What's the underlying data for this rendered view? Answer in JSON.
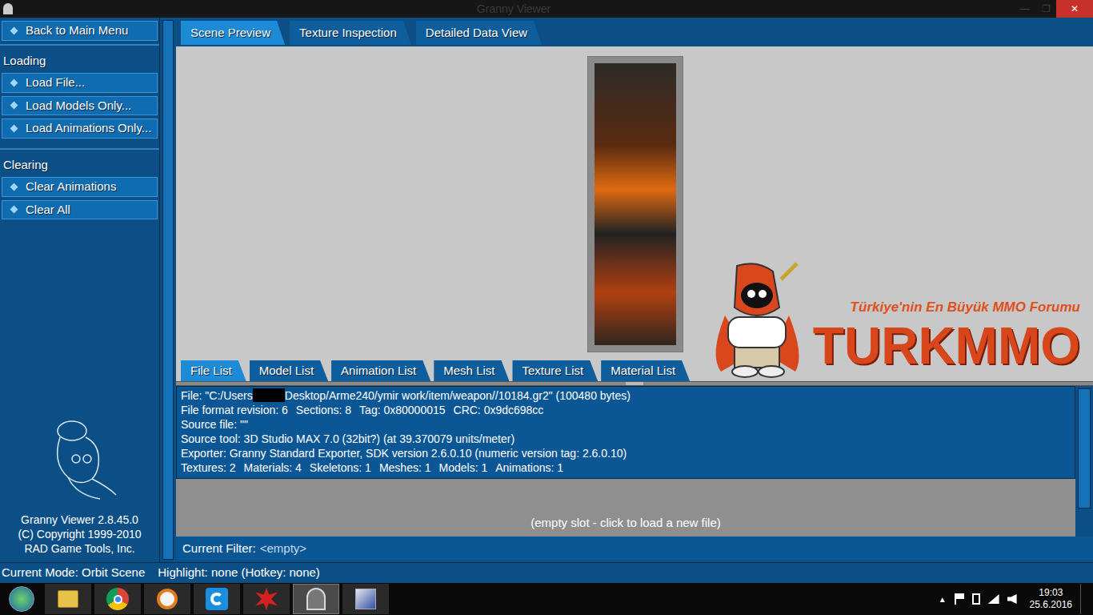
{
  "window": {
    "title": "Granny Viewer",
    "controls": [
      "—",
      "❐",
      "✕"
    ]
  },
  "sidebar": {
    "top": [
      "Back to Main Menu"
    ],
    "sections": [
      {
        "header": "Loading",
        "items": [
          "Load File...",
          "Load Models Only...",
          "Load Animations Only..."
        ]
      },
      {
        "header": "Clearing",
        "items": [
          "Clear Animations",
          "Clear All"
        ]
      }
    ],
    "credits": [
      "Granny Viewer 2.8.45.0",
      "(C) Copyright 1999-2010",
      "RAD Game Tools, Inc."
    ]
  },
  "main_tabs": [
    {
      "label": "Scene Preview",
      "selected": true
    },
    {
      "label": "Texture Inspection",
      "selected": false
    },
    {
      "label": "Detailed Data View",
      "selected": false
    }
  ],
  "preview": {
    "watermark": {
      "tagline": "Türkiye'nin En Büyük MMO Forumu",
      "name": "TURKMMO"
    }
  },
  "list_tabs": [
    {
      "label": "File List",
      "selected": true
    },
    {
      "label": "Model List",
      "selected": false
    },
    {
      "label": "Animation List",
      "selected": false
    },
    {
      "label": "Mesh List",
      "selected": false
    },
    {
      "label": "Texture List",
      "selected": false
    },
    {
      "label": "Material List",
      "selected": false
    }
  ],
  "file_info": {
    "path_before": "File: \"C:/Users",
    "path_redacted": true,
    "path_after": "Desktop/Arme240/ymir work/item/weapon//10184.gr2\" (100480 bytes)",
    "lines": [
      [
        "File format revision: 6",
        "Sections: 8",
        "Tag: 0x80000015",
        "CRC: 0x9dc698cc"
      ],
      [
        "Source file: \"\""
      ],
      [
        "Source tool: 3D Studio MAX 7.0 (32bit?) (at 39.370079 units/meter)"
      ],
      [
        "Exporter: Granny Standard Exporter, SDK version 2.6.0.10 (numeric version tag: 2.6.0.10)"
      ],
      [
        "Textures: 2",
        "Materials: 4",
        "Skeletons: 1",
        "Meshes: 1",
        "Models: 1",
        "Animations: 1"
      ]
    ]
  },
  "empty_slot": "(empty slot - click to load a new file)",
  "filter": {
    "label": "Current Filter:",
    "value": "<empty>"
  },
  "status_bar": {
    "mode": "Current Mode: Orbit Scene",
    "highlight": "Highlight: none (Hotkey: none)"
  },
  "taskbar": {
    "apps": [
      {
        "selected": false
      },
      {
        "selected": false
      },
      {
        "selected": false
      },
      {
        "selected": false
      },
      {
        "selected": false
      },
      {
        "selected": true
      },
      {
        "selected": false
      }
    ],
    "tray": {
      "arrow": "▲",
      "time": "19:03",
      "date": "25.6.2016"
    }
  }
}
